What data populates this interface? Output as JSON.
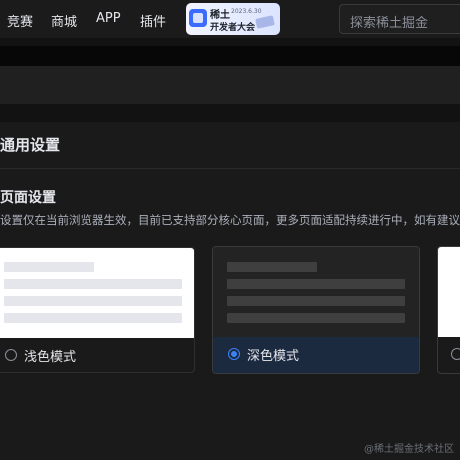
{
  "nav": {
    "items": [
      "竞赛",
      "商城",
      "APP",
      "插件"
    ],
    "banner": {
      "line1": "稀土",
      "date": "2023.6.30",
      "line2": "开发者大会"
    },
    "search_placeholder": "探索稀土掘金"
  },
  "settings": {
    "title": "通用设置",
    "section_title": "页面设置",
    "description": "设置仅在当前浏览器生效，目前已支持部分核心页面，更多页面适配持续进行中，如有建议可",
    "options": [
      {
        "label": "浅色模式",
        "selected": false
      },
      {
        "label": "深色模式",
        "selected": true
      }
    ]
  },
  "watermark": "@稀土掘金技术社区",
  "colors": {
    "accent": "#3b82f6",
    "background": "#121212",
    "selected_card": "#1c2a40"
  }
}
